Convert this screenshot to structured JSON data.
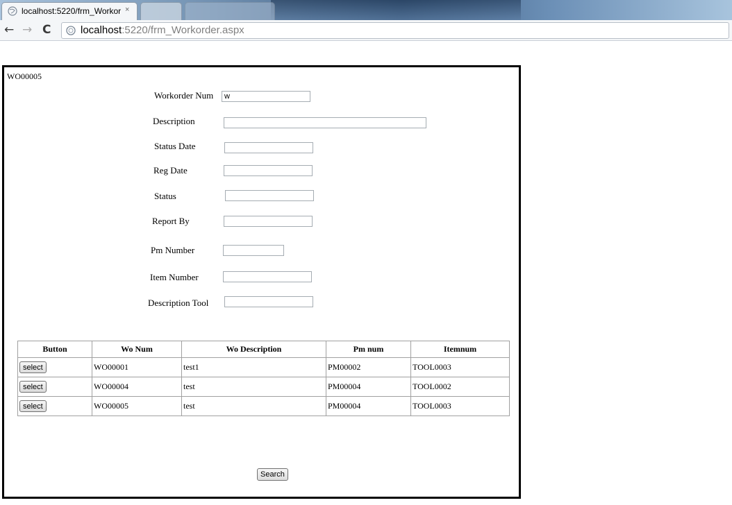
{
  "browser": {
    "tab_title": "localhost:5220/frm_Workor",
    "tab_close": "×",
    "url_host": "localhost",
    "url_path": ":5220/frm_Workorder.aspx",
    "back": "←",
    "forward": "→",
    "reload": "C"
  },
  "page": {
    "wo_label": "WO00005",
    "form": {
      "workorder_num": {
        "label": "Workorder Num",
        "value": "w"
      },
      "description": {
        "label": "Description",
        "value": ""
      },
      "status_date": {
        "label": "Status Date",
        "value": ""
      },
      "reg_date": {
        "label": "Reg Date",
        "value": ""
      },
      "status": {
        "label": "Status",
        "value": ""
      },
      "report_by": {
        "label": "Report By",
        "value": ""
      },
      "pm_number": {
        "label": "Pm Number",
        "value": ""
      },
      "item_number": {
        "label": "Item Number",
        "value": ""
      },
      "description_tool": {
        "label": "Description Tool",
        "value": ""
      }
    },
    "grid": {
      "headers": [
        "Button",
        "Wo Num",
        "Wo Description",
        "Pm num",
        "Itemnum"
      ],
      "rows": [
        {
          "button": "select",
          "wo_num": "WO00001",
          "wo_description": "test1",
          "pm_num": "PM00002",
          "itemnum": "TOOL0003"
        },
        {
          "button": "select",
          "wo_num": "WO00004",
          "wo_description": "test",
          "pm_num": "PM00004",
          "itemnum": "TOOL0002"
        },
        {
          "button": "select",
          "wo_num": "WO00005",
          "wo_description": "test",
          "pm_num": "PM00004",
          "itemnum": "TOOL0003"
        }
      ]
    },
    "search_button": "Search"
  }
}
